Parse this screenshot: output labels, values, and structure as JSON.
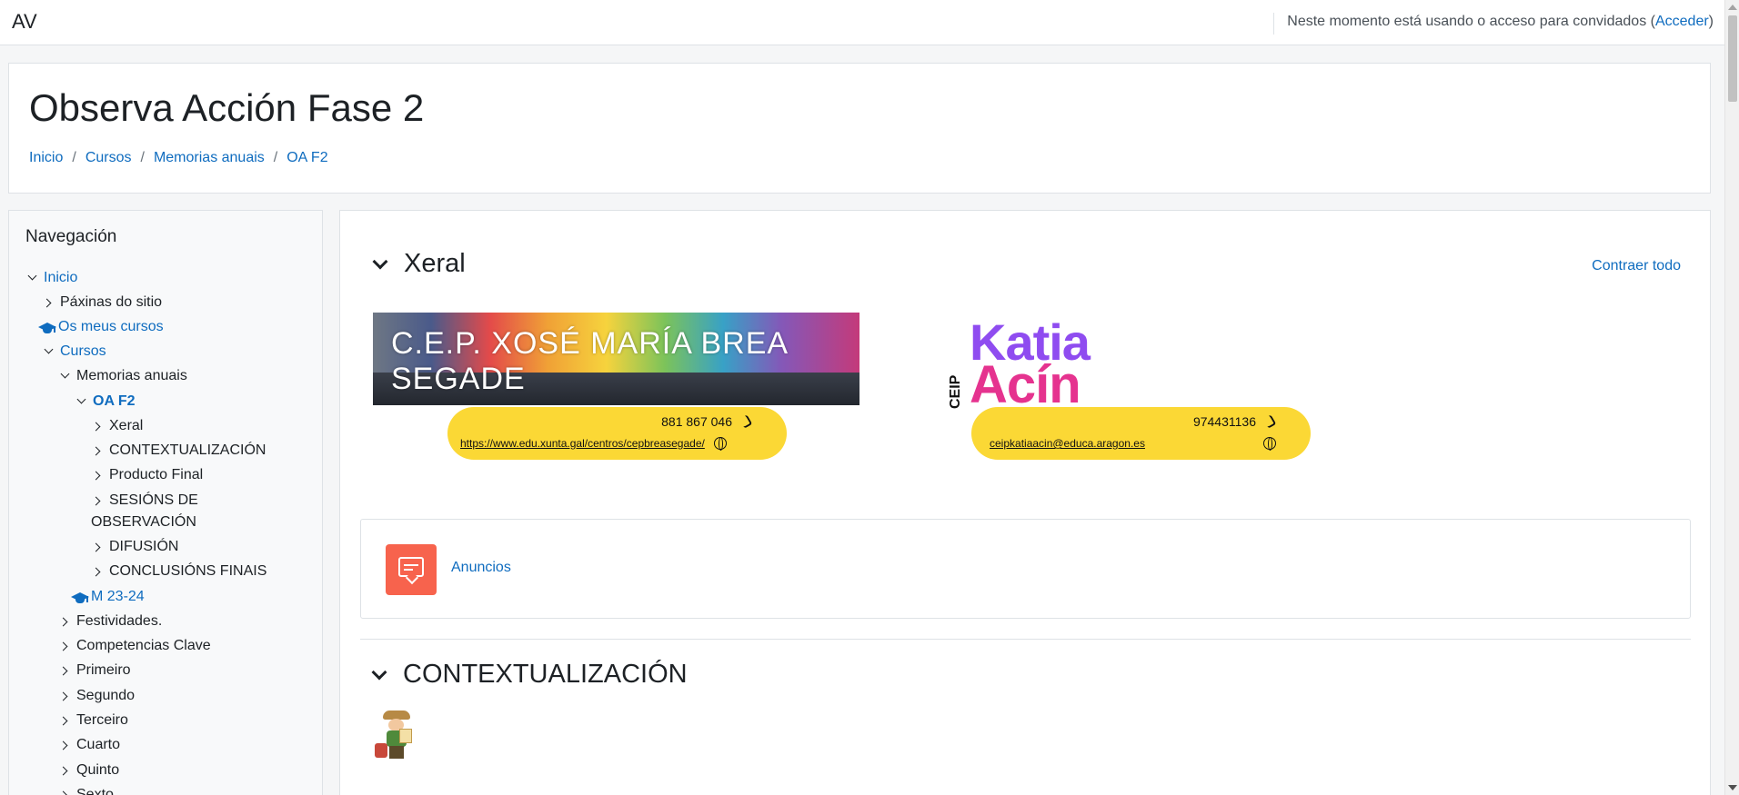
{
  "navbar": {
    "brand": "AV",
    "guest_text": "Neste momento está usando o acceso para convidados (",
    "login_label": "Acceder",
    "guest_close": ")"
  },
  "header": {
    "title": "Observa Acción Fase 2",
    "breadcrumb": [
      "Inicio",
      "Cursos",
      "Memorias anuais",
      "OA F2"
    ],
    "separator": "/"
  },
  "navigation": {
    "title": "Navegación",
    "items": [
      {
        "label": "Inicio",
        "state": "expanded",
        "type": "link"
      },
      {
        "label": "Páxinas do sitio",
        "state": "collapsed",
        "type": "text"
      },
      {
        "label": "Os meus cursos",
        "icon": "graduation-cap-icon",
        "type": "link"
      },
      {
        "label": "Cursos",
        "state": "expanded",
        "type": "link"
      },
      {
        "label": "Memorias anuais",
        "state": "expanded",
        "type": "text"
      },
      {
        "label": "OA F2",
        "state": "expanded",
        "type": "active"
      },
      {
        "label": "Xeral",
        "state": "collapsed",
        "type": "text"
      },
      {
        "label": "CONTEXTUALIZACIÓN",
        "state": "collapsed",
        "type": "text"
      },
      {
        "label": "Producto Final",
        "state": "collapsed",
        "type": "text"
      },
      {
        "label": "SESIÓNS DE",
        "label2": "OBSERVACIÓN",
        "state": "collapsed",
        "type": "text"
      },
      {
        "label": "DIFUSIÓN",
        "state": "collapsed",
        "type": "text"
      },
      {
        "label": "CONCLUSIÓNS FINAIS",
        "state": "collapsed",
        "type": "text"
      },
      {
        "label": "M 23-24",
        "icon": "graduation-cap-icon",
        "type": "link"
      },
      {
        "label": "Festividades.",
        "state": "collapsed",
        "type": "text"
      },
      {
        "label": "Competencias Clave",
        "state": "collapsed",
        "type": "text"
      },
      {
        "label": "Primeiro",
        "state": "collapsed",
        "type": "text"
      },
      {
        "label": "Segundo",
        "state": "collapsed",
        "type": "text"
      },
      {
        "label": "Terceiro",
        "state": "collapsed",
        "type": "text"
      },
      {
        "label": "Cuarto",
        "state": "collapsed",
        "type": "text"
      },
      {
        "label": "Quinto",
        "state": "collapsed",
        "type": "text"
      },
      {
        "label": "Sexto",
        "state": "collapsed",
        "type": "text"
      }
    ]
  },
  "main": {
    "collapse_all": "Contraer todo",
    "sections": [
      {
        "title": "Xeral"
      },
      {
        "title": "CONTEXTUALIZACIÓN"
      }
    ],
    "banners": {
      "school1": {
        "name": "C.E.P. XOSÉ MARÍA BREA SEGADE",
        "phone": "881 867 046",
        "web": "https://www.edu.xunta.gal/centros/cepbreasegade/"
      },
      "school2": {
        "name_line1": "Katia",
        "name_line2": "Acín",
        "prefix": "CEIP",
        "phone": "974431136",
        "email": "ceipkatiaacin@educa.aragon.es"
      }
    },
    "forum": {
      "label": "Anuncios",
      "icon": "forum-icon"
    }
  },
  "colors": {
    "link": "#0f6cbf",
    "forum_icon_bg": "#f7634d",
    "banner_pill": "#fbd835",
    "katia_purple": "#8f4cf0",
    "katia_pink": "#e5338f"
  }
}
